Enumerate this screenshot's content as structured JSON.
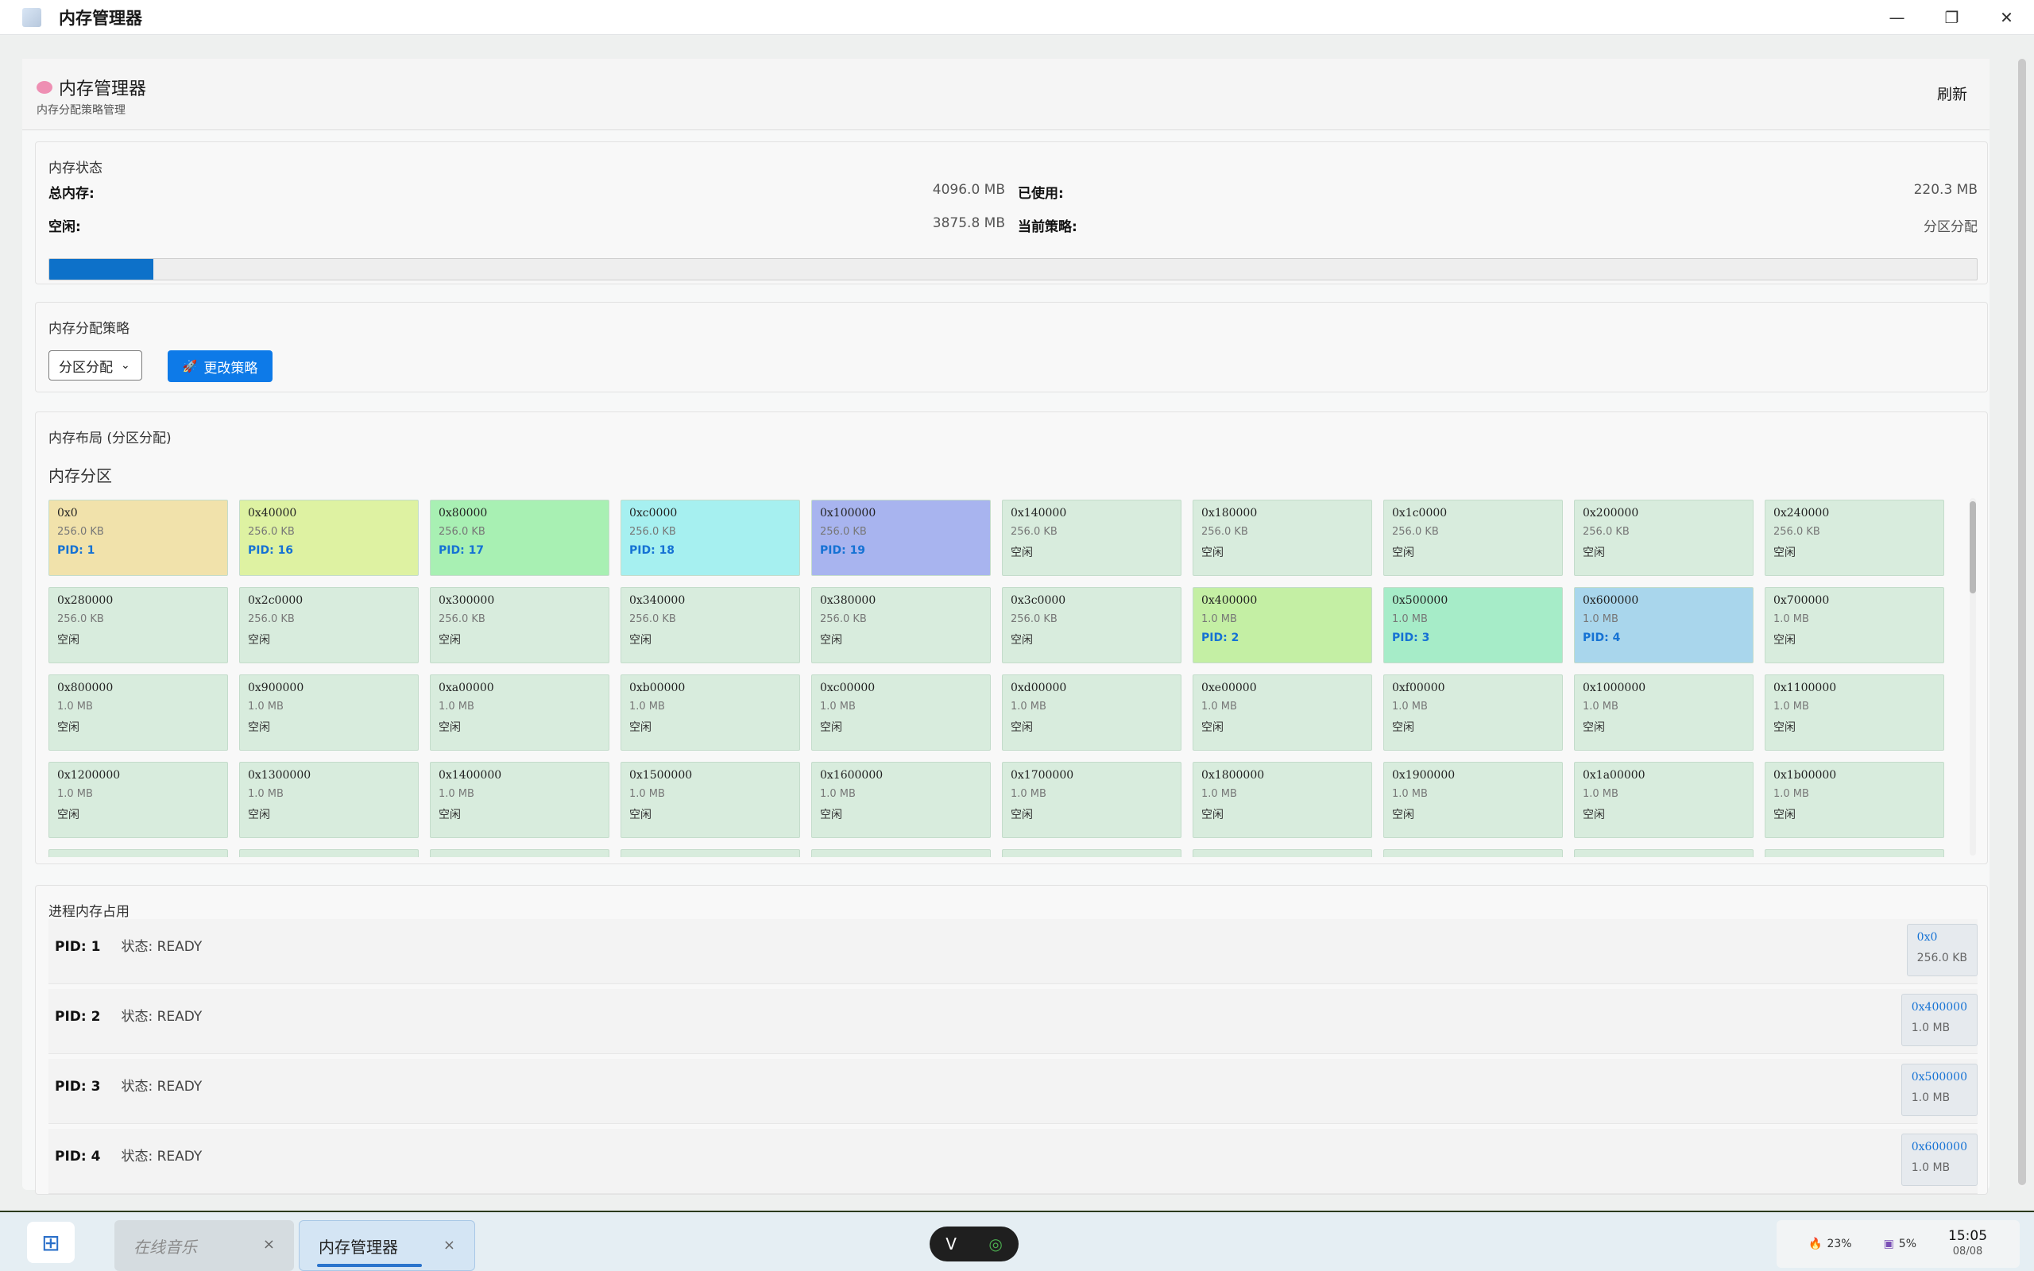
{
  "window": {
    "title": "内存管理器",
    "minimize": "—",
    "maximize": "❐",
    "close": "✕"
  },
  "header": {
    "title": "内存管理器",
    "subtitle": "内存分配策略管理",
    "refresh": "刷新"
  },
  "status": {
    "title": "内存状态",
    "total_label": "总内存:",
    "total_value": "4096.0 MB",
    "used_label": "已使用:",
    "used_value": "220.3 MB",
    "free_label": "空闲:",
    "free_value": "3875.8 MB",
    "policy_label": "当前策略:",
    "policy_value": "分区分配",
    "usage_fraction": 0.0538,
    "bar_color": "#0d71c9"
  },
  "strategy": {
    "title": "内存分配策略",
    "selected": "分区分配",
    "change_label": "更改策略",
    "rocket_icon": "🚀"
  },
  "layout": {
    "title": "内存布局 (分区分配)",
    "subtitle": "内存分区",
    "partitions": [
      {
        "addr": "0x0",
        "size": "256.0 KB",
        "pid": "PID: 1",
        "used": true,
        "color": "#f1e2ab"
      },
      {
        "addr": "0x40000",
        "size": "256.0 KB",
        "pid": "PID: 16",
        "used": true,
        "color": "#def2a2"
      },
      {
        "addr": "0x80000",
        "size": "256.0 KB",
        "pid": "PID: 17",
        "used": true,
        "color": "#a8f0b3"
      },
      {
        "addr": "0xc0000",
        "size": "256.0 KB",
        "pid": "PID: 18",
        "used": true,
        "color": "#a6f0f0"
      },
      {
        "addr": "0x100000",
        "size": "256.0 KB",
        "pid": "PID: 19",
        "used": true,
        "color": "#a8b4ef"
      },
      {
        "addr": "0x140000",
        "size": "256.0 KB",
        "pid": "空闲",
        "used": false,
        "color": "#d8ecdd"
      },
      {
        "addr": "0x180000",
        "size": "256.0 KB",
        "pid": "空闲",
        "used": false,
        "color": "#d8ecdd"
      },
      {
        "addr": "0x1c0000",
        "size": "256.0 KB",
        "pid": "空闲",
        "used": false,
        "color": "#d8ecdd"
      },
      {
        "addr": "0x200000",
        "size": "256.0 KB",
        "pid": "空闲",
        "used": false,
        "color": "#d8ecdd"
      },
      {
        "addr": "0x240000",
        "size": "256.0 KB",
        "pid": "空闲",
        "used": false,
        "color": "#d8ecdd"
      },
      {
        "addr": "0x280000",
        "size": "256.0 KB",
        "pid": "空闲",
        "used": false,
        "color": "#d8ecdd"
      },
      {
        "addr": "0x2c0000",
        "size": "256.0 KB",
        "pid": "空闲",
        "used": false,
        "color": "#d8ecdd"
      },
      {
        "addr": "0x300000",
        "size": "256.0 KB",
        "pid": "空闲",
        "used": false,
        "color": "#d8ecdd"
      },
      {
        "addr": "0x340000",
        "size": "256.0 KB",
        "pid": "空闲",
        "used": false,
        "color": "#d8ecdd"
      },
      {
        "addr": "0x380000",
        "size": "256.0 KB",
        "pid": "空闲",
        "used": false,
        "color": "#d8ecdd"
      },
      {
        "addr": "0x3c0000",
        "size": "256.0 KB",
        "pid": "空闲",
        "used": false,
        "color": "#d8ecdd"
      },
      {
        "addr": "0x400000",
        "size": "1.0 MB",
        "pid": "PID: 2",
        "used": true,
        "color": "#c4efa4"
      },
      {
        "addr": "0x500000",
        "size": "1.0 MB",
        "pid": "PID: 3",
        "used": true,
        "color": "#a6ecc8"
      },
      {
        "addr": "0x600000",
        "size": "1.0 MB",
        "pid": "PID: 4",
        "used": true,
        "color": "#a9d6ec"
      },
      {
        "addr": "0x700000",
        "size": "1.0 MB",
        "pid": "空闲",
        "used": false,
        "color": "#d8ecdd"
      },
      {
        "addr": "0x800000",
        "size": "1.0 MB",
        "pid": "空闲",
        "used": false,
        "color": "#d8ecdd"
      },
      {
        "addr": "0x900000",
        "size": "1.0 MB",
        "pid": "空闲",
        "used": false,
        "color": "#d8ecdd"
      },
      {
        "addr": "0xa00000",
        "size": "1.0 MB",
        "pid": "空闲",
        "used": false,
        "color": "#d8ecdd"
      },
      {
        "addr": "0xb00000",
        "size": "1.0 MB",
        "pid": "空闲",
        "used": false,
        "color": "#d8ecdd"
      },
      {
        "addr": "0xc00000",
        "size": "1.0 MB",
        "pid": "空闲",
        "used": false,
        "color": "#d8ecdd"
      },
      {
        "addr": "0xd00000",
        "size": "1.0 MB",
        "pid": "空闲",
        "used": false,
        "color": "#d8ecdd"
      },
      {
        "addr": "0xe00000",
        "size": "1.0 MB",
        "pid": "空闲",
        "used": false,
        "color": "#d8ecdd"
      },
      {
        "addr": "0xf00000",
        "size": "1.0 MB",
        "pid": "空闲",
        "used": false,
        "color": "#d8ecdd"
      },
      {
        "addr": "0x1000000",
        "size": "1.0 MB",
        "pid": "空闲",
        "used": false,
        "color": "#d8ecdd"
      },
      {
        "addr": "0x1100000",
        "size": "1.0 MB",
        "pid": "空闲",
        "used": false,
        "color": "#d8ecdd"
      },
      {
        "addr": "0x1200000",
        "size": "1.0 MB",
        "pid": "空闲",
        "used": false,
        "color": "#d8ecdd"
      },
      {
        "addr": "0x1300000",
        "size": "1.0 MB",
        "pid": "空闲",
        "used": false,
        "color": "#d8ecdd"
      },
      {
        "addr": "0x1400000",
        "size": "1.0 MB",
        "pid": "空闲",
        "used": false,
        "color": "#d8ecdd"
      },
      {
        "addr": "0x1500000",
        "size": "1.0 MB",
        "pid": "空闲",
        "used": false,
        "color": "#d8ecdd"
      },
      {
        "addr": "0x1600000",
        "size": "1.0 MB",
        "pid": "空闲",
        "used": false,
        "color": "#d8ecdd"
      },
      {
        "addr": "0x1700000",
        "size": "1.0 MB",
        "pid": "空闲",
        "used": false,
        "color": "#d8ecdd"
      },
      {
        "addr": "0x1800000",
        "size": "1.0 MB",
        "pid": "空闲",
        "used": false,
        "color": "#d8ecdd"
      },
      {
        "addr": "0x1900000",
        "size": "1.0 MB",
        "pid": "空闲",
        "used": false,
        "color": "#d8ecdd"
      },
      {
        "addr": "0x1a00000",
        "size": "1.0 MB",
        "pid": "空闲",
        "used": false,
        "color": "#d8ecdd"
      },
      {
        "addr": "0x1b00000",
        "size": "1.0 MB",
        "pid": "空闲",
        "used": false,
        "color": "#d8ecdd"
      }
    ]
  },
  "processes": {
    "title": "进程内存占用",
    "rows": [
      {
        "pid": "PID: 1",
        "state": "状态: READY",
        "addr": "0x0",
        "size": "256.0 KB"
      },
      {
        "pid": "PID: 2",
        "state": "状态: READY",
        "addr": "0x400000",
        "size": "1.0 MB"
      },
      {
        "pid": "PID: 3",
        "state": "状态: READY",
        "addr": "0x500000",
        "size": "1.0 MB"
      },
      {
        "pid": "PID: 4",
        "state": "状态: READY",
        "addr": "0x600000",
        "size": "1.0 MB"
      }
    ]
  },
  "taskbar": {
    "start_icon": "⊞",
    "tabs": [
      {
        "label": "在线音乐",
        "close": "×"
      },
      {
        "label": "内存管理器",
        "close": "×"
      }
    ],
    "cpu": "23%",
    "mem": "5%",
    "time": "15:05",
    "date": "08/08"
  }
}
